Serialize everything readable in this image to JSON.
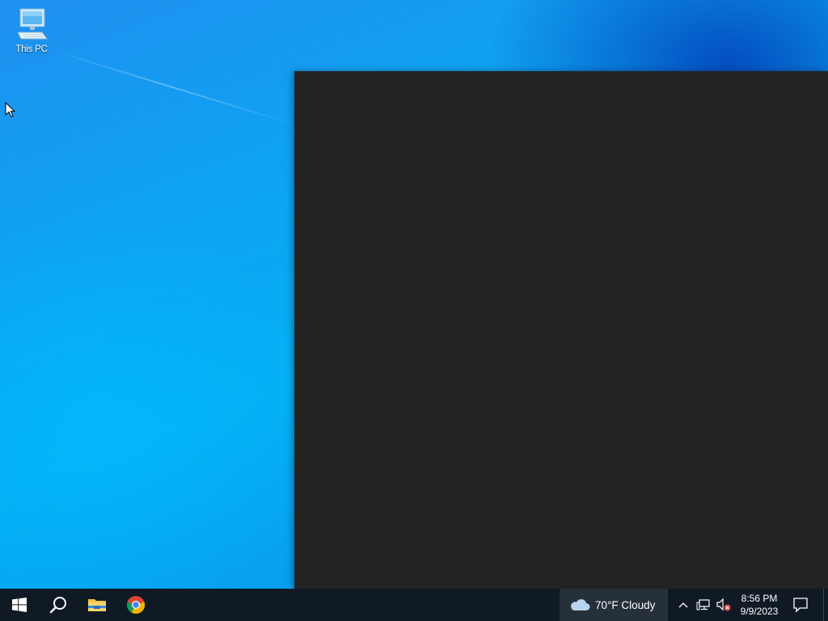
{
  "desktop": {
    "icons": [
      {
        "label": "This PC",
        "icon": "this-pc-icon"
      }
    ]
  },
  "window": {
    "background": "#232323"
  },
  "taskbar": {
    "background": "#101a25",
    "pinned": [
      {
        "name": "start",
        "icon": "windows-logo-icon"
      },
      {
        "name": "search",
        "icon": "search-icon"
      },
      {
        "name": "file-explorer",
        "icon": "file-explorer-icon"
      },
      {
        "name": "chrome",
        "icon": "chrome-icon"
      }
    ],
    "weather": {
      "icon": "cloud-icon",
      "text": "70°F  Cloudy"
    },
    "tray": {
      "icons": [
        "chevron-up-icon",
        "network-icon",
        "volume-muted-icon"
      ]
    },
    "clock": {
      "time": "8:56 PM",
      "date": "9/9/2023"
    },
    "notifications_icon": "notification-icon"
  }
}
